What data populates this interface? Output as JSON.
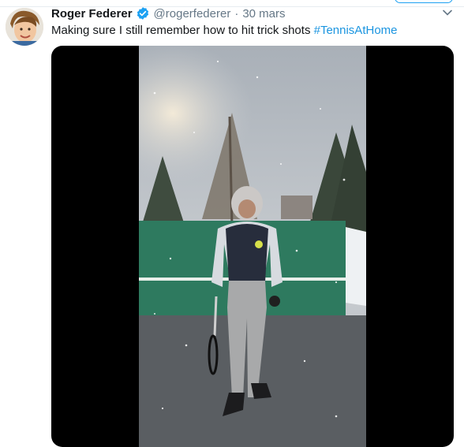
{
  "tweet": {
    "author_name": "Roger Federer",
    "author_handle": "@rogerfederer",
    "separator": "·",
    "date": "30 mars",
    "text_main": "Making sure I still remember how to hit trick shots ",
    "hashtag": "#TennisAtHome"
  },
  "icons": {
    "verified": "verified-badge-icon",
    "caret": "chevron-down-icon"
  },
  "colors": {
    "accent": "#1da1f2",
    "hashtag": "#1b95e0",
    "secondary_text": "#657786",
    "primary_text": "#14171a"
  }
}
